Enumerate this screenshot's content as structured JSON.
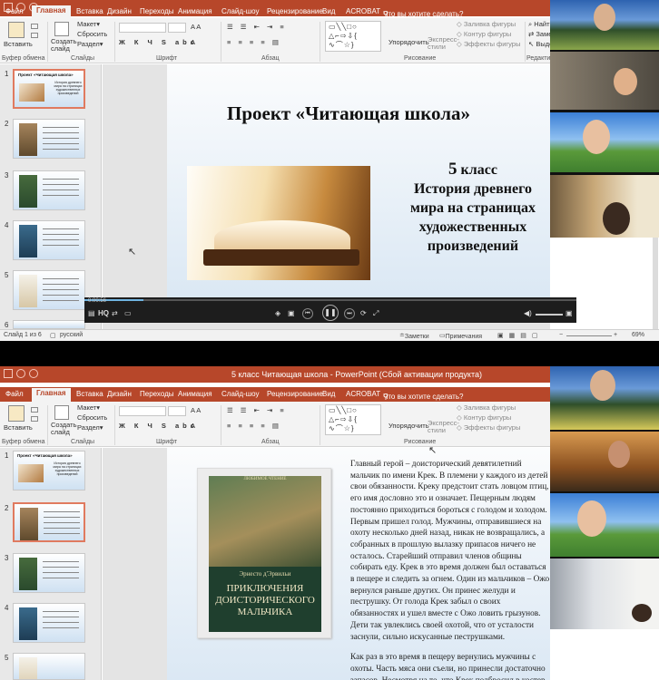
{
  "window": {
    "title": "5 класс Читающая школа - PowerPoint (Сбой активации продукта)",
    "tell_me": "Что вы хотите сделать?",
    "sign_in": "Найти"
  },
  "tabs": [
    "Файл",
    "Главная",
    "Вставка",
    "Дизайн",
    "Переходы",
    "Анимация",
    "Слайд-шоу",
    "Рецензирование",
    "Вид",
    "ACROBAT"
  ],
  "ribbon": {
    "paste": "Вставить",
    "create_slide": "Создать слайд",
    "layout": "Макет",
    "reset": "Сбросить",
    "section": "Раздел",
    "arrange": "Упорядочить",
    "quick_styles": "Экспресс-стили",
    "shape_fill": "Заливка фигуры",
    "shape_outline": "Контур фигуры",
    "shape_effects": "Эффекты фигуры",
    "replace": "Заменить",
    "select": "Выделить",
    "groups": {
      "clipboard": "Буфер обмена",
      "slides": "Слайды",
      "font": "Шрифт",
      "paragraph": "Абзац",
      "drawing": "Рисование",
      "editing": "Редактирование"
    }
  },
  "top_slide": {
    "title": "Проект «Читающая школа»",
    "grade_num": "5",
    "grade": "класс",
    "subtitle": "История древнего мира на страницах художественных произведений"
  },
  "thumbs_top": [
    {
      "num": "1",
      "title": "Проект «Читающая школа»"
    },
    {
      "num": "2"
    },
    {
      "num": "3"
    },
    {
      "num": "4"
    },
    {
      "num": "5"
    },
    {
      "num": "6"
    }
  ],
  "thumbs_bottom": [
    {
      "num": "1",
      "title": "Проект «Читающая школа»"
    },
    {
      "num": "2"
    },
    {
      "num": "3"
    },
    {
      "num": "4"
    },
    {
      "num": "5"
    }
  ],
  "video": {
    "time": "0:00:56",
    "progress": 0.12,
    "hq": "HQ"
  },
  "status": {
    "slide": "Слайд 1 из 6",
    "lang": "русский",
    "notes": "Заметки",
    "comments": "Примечания",
    "zoom": "69%"
  },
  "book": {
    "series": "ЛЮБИМОЕ ЧТЕНИЕ",
    "author": "Эрнесто д'Эрвильи",
    "title": "ПРИКЛЮЧЕНИЯ ДОИСТОРИЧЕСКОГО МАЛЬЧИКА"
  },
  "story": {
    "p1": "Главный герой – доисторический девятилетний мальчик по имени Крек. В племени у каждого из детей свои обязанности. Креку предстоит стать ловцом птиц, его имя дословно это и означает. Пещерным людям постоянно приходиться бороться с голодом и холодом. Первым пришел голод. Мужчины, отправившиеся на охоту несколько дней назад, никак не возвращались, а собранных в прошлую вылазку припасов ничего не осталось. Старейший отправил членов общины собирать еду. Крек в это время должен был оставаться в пещере и следить за огнем. Один из мальчиков – Ожо вернулся раньше других. Он принес желуди и пеструшку. От голода Крек забыл о своих обязанностях и ушел вместе с Ожо ловить грызунов. Дети так увлеклись своей охотой, что от усталости заснули, сильно искусанные пеструшками.",
    "p2": "Как раз в это время в пещеру вернулись мужчины с охоты. Часть мяса они съели, но принесли достаточно запасов. Несмотря на то, что Крек подбросил в костер"
  },
  "colors": {
    "accent": "#b7472a",
    "ribbon": "#f3f3f3",
    "panel": "#e8e8e8"
  }
}
